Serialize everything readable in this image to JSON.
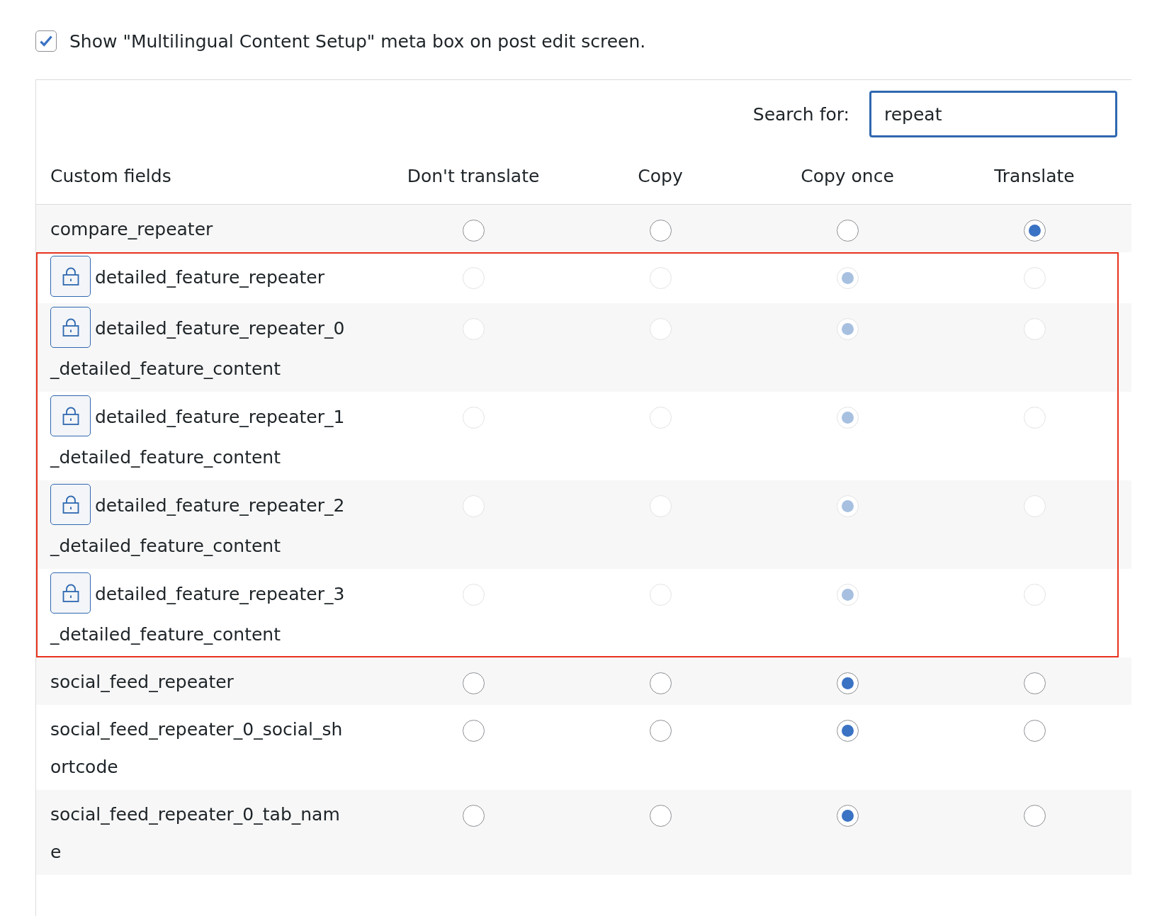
{
  "show_meta_box": {
    "label": "Show \"Multilingual Content Setup\" meta box on post edit screen.",
    "checked": true
  },
  "search": {
    "label": "Search for:",
    "value": "repeat"
  },
  "table": {
    "columns": [
      "Custom fields",
      "Don't translate",
      "Copy",
      "Copy once",
      "Translate"
    ],
    "rows": [
      {
        "name": "compare_repeater",
        "locked": false,
        "highlighted": false,
        "options": [
          {
            "selected": false
          },
          {
            "selected": false
          },
          {
            "selected": false
          },
          {
            "selected": true
          }
        ]
      },
      {
        "name": "detailed_feature_repeater",
        "locked": true,
        "highlighted": true,
        "options": [
          {
            "selected": false
          },
          {
            "selected": false
          },
          {
            "selected": true
          },
          {
            "selected": false
          }
        ]
      },
      {
        "name": "detailed_feature_repeater_0_detailed_feature_content",
        "locked": true,
        "highlighted": true,
        "options": [
          {
            "selected": false
          },
          {
            "selected": false
          },
          {
            "selected": true
          },
          {
            "selected": false
          }
        ]
      },
      {
        "name": "detailed_feature_repeater_1_detailed_feature_content",
        "locked": true,
        "highlighted": true,
        "options": [
          {
            "selected": false
          },
          {
            "selected": false
          },
          {
            "selected": true
          },
          {
            "selected": false
          }
        ]
      },
      {
        "name": "detailed_feature_repeater_2_detailed_feature_content",
        "locked": true,
        "highlighted": true,
        "options": [
          {
            "selected": false
          },
          {
            "selected": false
          },
          {
            "selected": true
          },
          {
            "selected": false
          }
        ]
      },
      {
        "name": "detailed_feature_repeater_3_detailed_feature_content",
        "locked": true,
        "highlighted": true,
        "options": [
          {
            "selected": false
          },
          {
            "selected": false
          },
          {
            "selected": true
          },
          {
            "selected": false
          }
        ]
      },
      {
        "name": "social_feed_repeater",
        "locked": false,
        "highlighted": false,
        "options": [
          {
            "selected": false
          },
          {
            "selected": false
          },
          {
            "selected": true
          },
          {
            "selected": false
          }
        ]
      },
      {
        "name": "social_feed_repeater_0_social_shortcode",
        "locked": false,
        "highlighted": false,
        "options": [
          {
            "selected": false
          },
          {
            "selected": false
          },
          {
            "selected": true
          },
          {
            "selected": false
          }
        ]
      },
      {
        "name": "social_feed_repeater_0_tab_name",
        "locked": false,
        "highlighted": false,
        "options": [
          {
            "selected": false
          },
          {
            "selected": false
          },
          {
            "selected": true
          },
          {
            "selected": false
          }
        ]
      }
    ]
  }
}
